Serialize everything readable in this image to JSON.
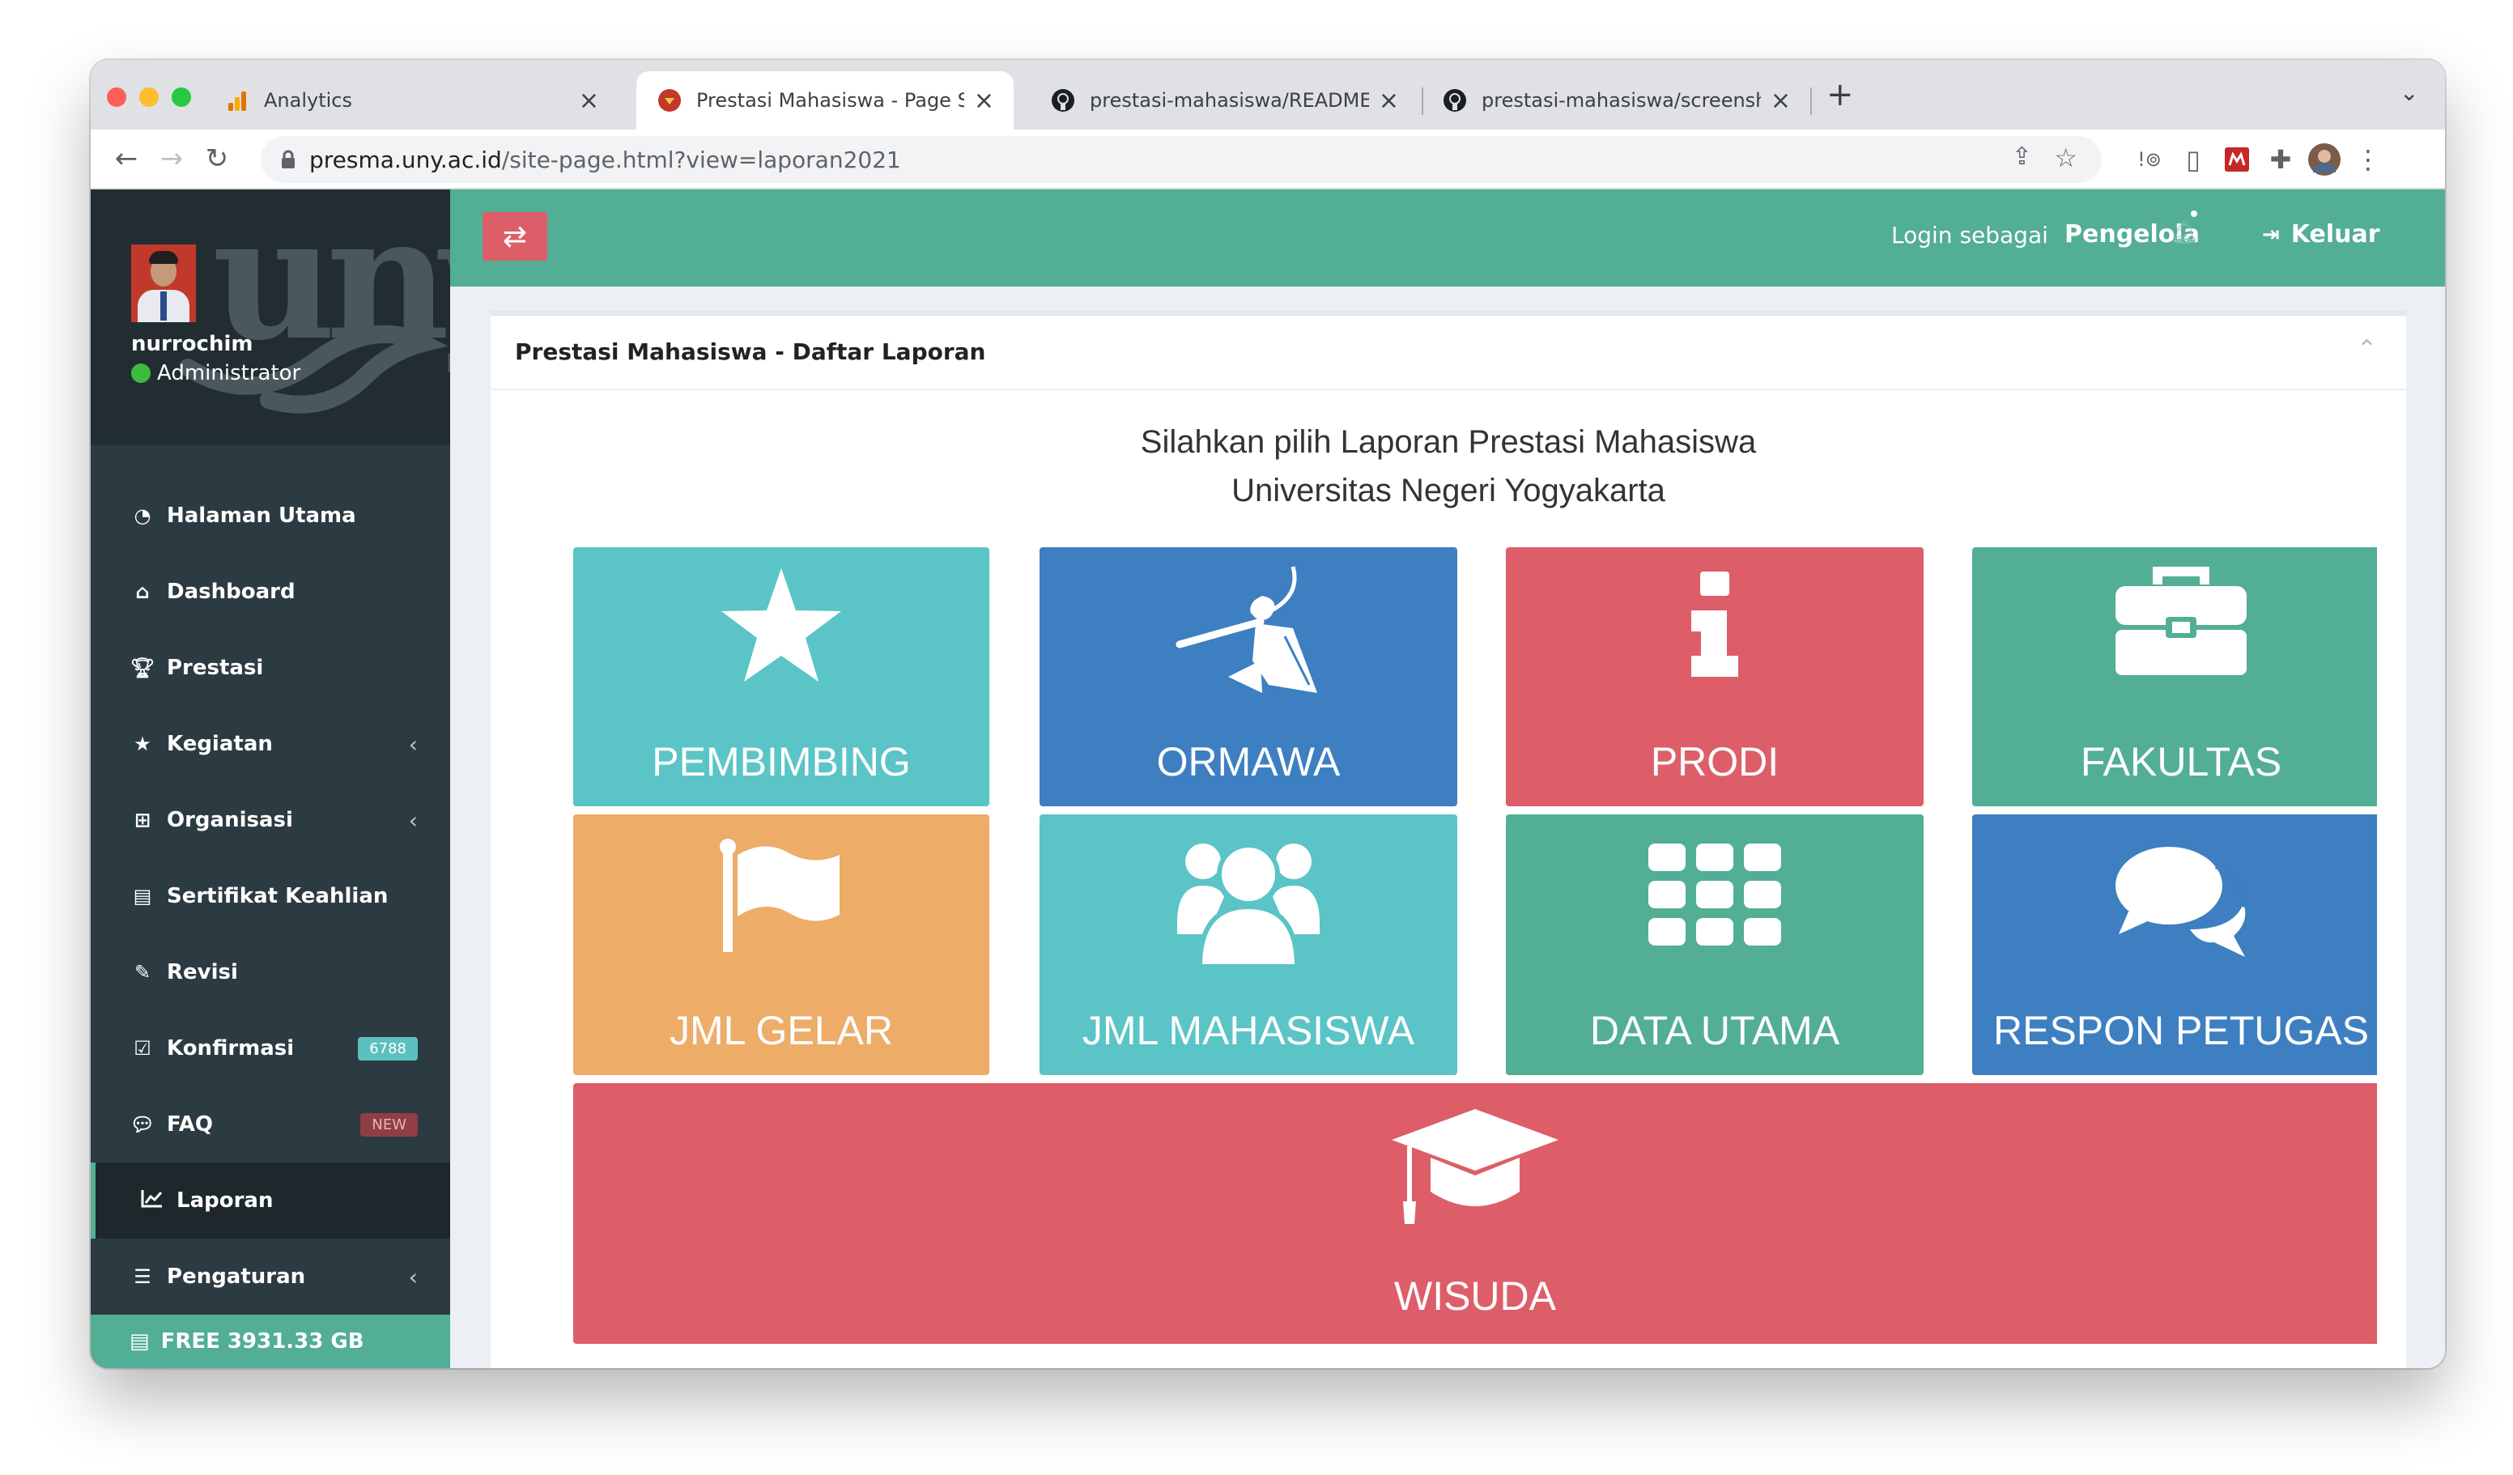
{
  "browser": {
    "tabs": [
      {
        "title": "Analytics",
        "icon": "analytics-icon"
      },
      {
        "title": "Prestasi Mahasiswa - Page Site",
        "icon": "site-favicon"
      },
      {
        "title": "prestasi-mahasiswa/README.m",
        "icon": "github-icon"
      },
      {
        "title": "prestasi-mahasiswa/screensho",
        "icon": "github-icon"
      }
    ],
    "new_tab": "+",
    "url_host": "presma.uny.ac.id",
    "url_path": "/site-page.html?view=laporan2021"
  },
  "user": {
    "name": "nurrochim",
    "role": "Administrator",
    "logo_text": "uny"
  },
  "menu": [
    {
      "label": "Halaman Utama",
      "icon": "dashboard-gauge-icon"
    },
    {
      "label": "Dashboard",
      "icon": "home-icon"
    },
    {
      "label": "Prestasi",
      "icon": "trophy-icon"
    },
    {
      "label": "Kegiatan",
      "icon": "star-icon",
      "chevron": "‹"
    },
    {
      "label": "Organisasi",
      "icon": "sitemap-icon",
      "chevron": "‹"
    },
    {
      "label": "Sertifikat Keahlian",
      "icon": "certificate-icon"
    },
    {
      "label": "Revisi",
      "icon": "edit-icon"
    },
    {
      "label": "Konfirmasi",
      "icon": "check-square-icon",
      "badge": "6788",
      "badge_color": "#5bc0be"
    },
    {
      "label": "FAQ",
      "icon": "comments-icon",
      "badge": "NEW",
      "badge_color": "#dd5e69"
    },
    {
      "label": "Laporan",
      "icon": "line-chart-icon",
      "active": true
    },
    {
      "label": "Pengaturan",
      "icon": "list-alt-icon",
      "chevron": "‹"
    }
  ],
  "storage": {
    "label": "FREE 3931.33 GB"
  },
  "header": {
    "toggle_icon": "⇄",
    "login_as": "Login sebagai",
    "role": "Pengelola",
    "logout": "Keluar"
  },
  "panel": {
    "title": "Prestasi Mahasiswa - Daftar Laporan",
    "collapse_icon": "⌃",
    "heading_line1": "Silahkan pilih Laporan Prestasi Mahasiswa",
    "heading_line2": "Universitas Negeri Yogyakarta"
  },
  "tiles": [
    {
      "label": "PEMBIMBING",
      "icon": "star-icon",
      "color": "#5bc4c6"
    },
    {
      "label": "ORMAWA",
      "icon": "mascot-icon",
      "color": "#3d7fc1"
    },
    {
      "label": "PRODI",
      "icon": "info-icon",
      "color": "#dd5e69"
    },
    {
      "label": "FAKULTAS",
      "icon": "briefcase-icon",
      "color": "#52ae94"
    },
    {
      "label": "JML GELAR",
      "icon": "flag-icon",
      "color": "#edac68"
    },
    {
      "label": "JML MAHASISWA",
      "icon": "users-icon",
      "color": "#5bc4c6"
    },
    {
      "label": "DATA UTAMA",
      "icon": "grid-icon",
      "color": "#52ae94"
    },
    {
      "label": "RESPON PETUGAS",
      "icon": "comments-icon",
      "color": "#3d7fc1"
    },
    {
      "label": "WISUDA",
      "icon": "graduation-cap-icon",
      "color": "#dd5e69"
    }
  ]
}
